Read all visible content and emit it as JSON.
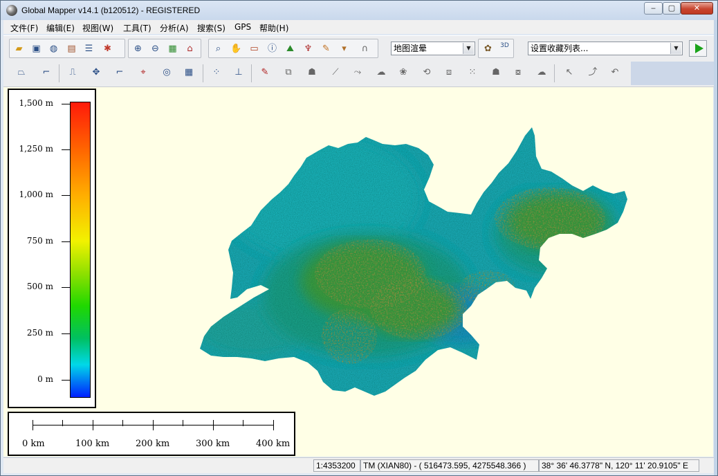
{
  "window": {
    "title": "Global Mapper v14.1 (b120512) - REGISTERED",
    "minimize_glyph": "‒",
    "maximize_glyph": "▢",
    "close_glyph": "✕"
  },
  "menu": [
    "文件(F)",
    "编辑(E)",
    "视图(W)",
    "工具(T)",
    "分析(A)",
    "搜索(S)",
    "GPS",
    "帮助(H)"
  ],
  "toolbar": {
    "render_mode": "地图渲晕",
    "favorites_placeholder": "设置收藏列表...",
    "icon_3d_label": "3D"
  },
  "legend": {
    "labels": [
      "1,500 m",
      "1,250 m",
      "1,000 m",
      "750 m",
      "500 m",
      "250 m",
      "0 m"
    ]
  },
  "scale_bar": {
    "labels": [
      "0 km",
      "100 km",
      "200 km",
      "300 km",
      "400 km"
    ]
  },
  "status": {
    "scale": "1:4353200",
    "projection": "TM (XIAN80) - ( 516473.595, 4275548.366 )",
    "coordinates": "38° 36' 46.3778\" N, 120° 11' 20.9105\" E"
  }
}
